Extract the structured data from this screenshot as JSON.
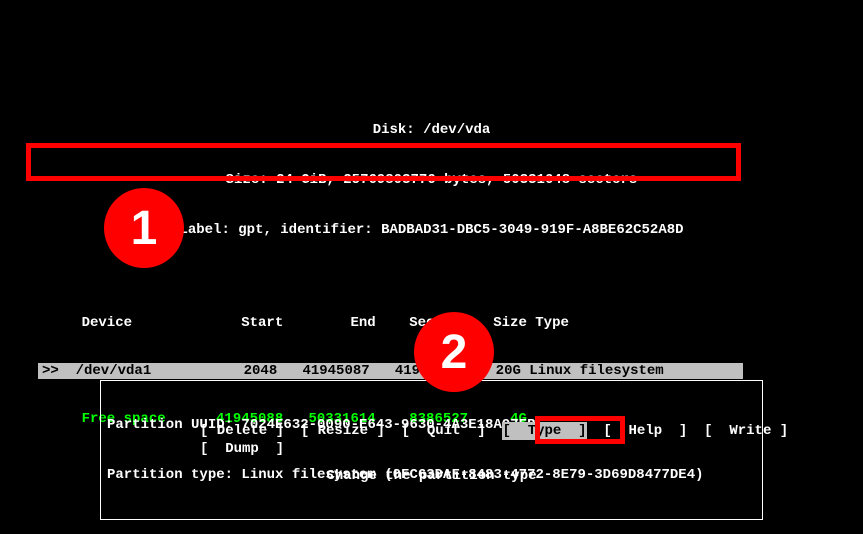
{
  "header": {
    "disk": "Disk: /dev/vda",
    "size": "Size: 24 GiB, 25769803776 bytes, 50331648 sectors",
    "label": "Label: gpt, identifier: BADBAD31-DBC5-3049-919F-A8BE62C52A8D"
  },
  "columns": "    Device             Start        End    Sectors   Size Type",
  "rows": {
    "selected": ">>  /dev/vda1           2048   41945087   41943040    20G Linux filesystem ",
    "free": "    Free space      41945088   50331614    8386527     4G"
  },
  "info": {
    "uuid": "Partition UUID: 7024E632-0090-E643-9630-4A3E18A97EB",
    "type": "Partition type: Linux filesystem (0FC63DAF-8483-4772-8E79-3D69D8477DE4)"
  },
  "menu": {
    "delete": "[ Delete ]",
    "resize": "[ Resize ]",
    "quit": "[  Quit  ]",
    "type": "[  Type  ]",
    "help": "[  Help  ]",
    "write": "[  Write ]",
    "dump": "[  Dump  ]"
  },
  "hint": "Change the partition type",
  "annotations": {
    "badge1": "1",
    "badge2": "2"
  }
}
